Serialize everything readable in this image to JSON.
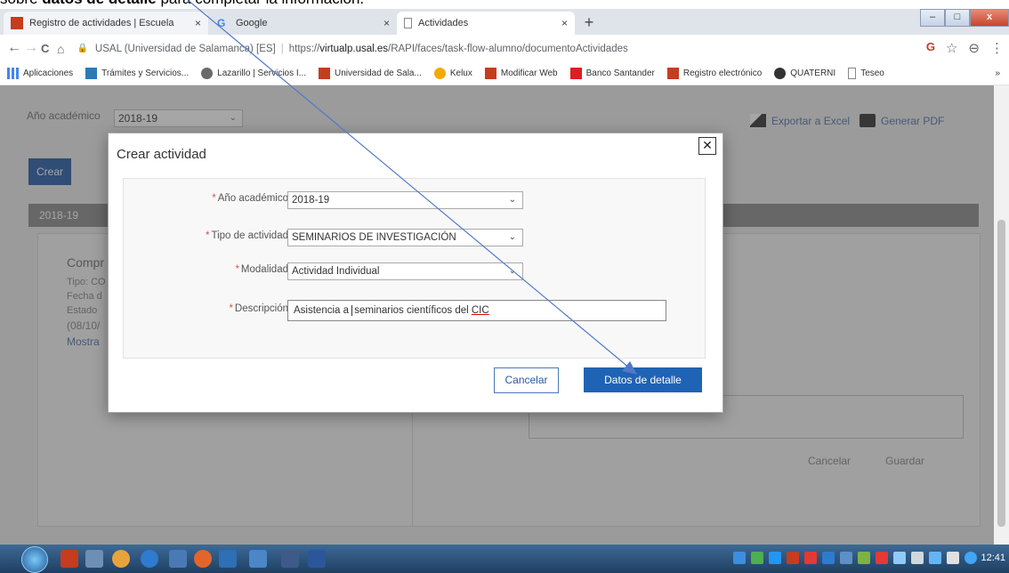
{
  "caption": {
    "prefix": "sobre ",
    "bold": "datos de detalle",
    "suffix": " para completar la información."
  },
  "browser": {
    "tabs": [
      {
        "title": "Registro de actividades | Escuela",
        "color": "#c63c1f"
      },
      {
        "title": "Google",
        "color": "#4285f4"
      },
      {
        "title": "Actividades",
        "color": "#888888"
      }
    ],
    "tab_close": "×",
    "new_tab": "+",
    "window_controls": {
      "minimize": "–",
      "maximize": "□",
      "close": "x"
    },
    "nav": {
      "back": "←",
      "forward": "→",
      "reload": "C",
      "home": "⌂"
    },
    "url": {
      "site": "USAL (Universidad de Salamanca) [ES]",
      "prefix": "https://",
      "domain": "virtualp.usal.es",
      "path": "/RAPI/faces/task-flow-alumno/documentoActividades"
    },
    "addr_icons": {
      "ext": "G",
      "star": "☆",
      "profile": "⊖",
      "menu": "⋮"
    },
    "bookmarks": [
      {
        "label": "Aplicaciones",
        "color": "#4285f4"
      },
      {
        "label": "Trámites y Servicios...",
        "color": "#2a7ab8"
      },
      {
        "label": "Lazarillo | Servicios I...",
        "color": "#6a6a6a"
      },
      {
        "label": "Universidad de Sala...",
        "color": "#c63c1f"
      },
      {
        "label": "Kelux",
        "color": "#f2a900"
      },
      {
        "label": "Modificar Web",
        "color": "#c63c1f"
      },
      {
        "label": "Banco Santander",
        "color": "#e31b23"
      },
      {
        "label": "Registro electrónico",
        "color": "#c63c1f"
      },
      {
        "label": "QUATERNI",
        "color": "#333333"
      },
      {
        "label": "Teseo",
        "color": "#888888"
      }
    ],
    "bookmarks_more": "»"
  },
  "page": {
    "year_filter_label": "Año académico",
    "year_filter_value": "2018-19",
    "export_excel": "Exportar a Excel",
    "export_pdf": "Generar PDF",
    "crear": "Crear",
    "year_bar": "2018-19",
    "comp_title": "Compr",
    "comp_lines": [
      "Tipo: CO",
      "Fecha d",
      "Estado",
      "(08/10/",
      "Mostra"
    ],
    "bg_cancel": "Cancelar",
    "bg_guardar": "Guardar"
  },
  "modal": {
    "title": "Crear actividad",
    "close": "✕",
    "fields": [
      {
        "label": "Año académico",
        "value": "2018-19"
      },
      {
        "label": "Tipo de actividad",
        "value": "SEMINARIOS DE INVESTIGACIÓN"
      },
      {
        "label": "Modalidad",
        "value": "Actividad Individual"
      }
    ],
    "description_label": "Descripción",
    "description_value_a": "Asistencia a ",
    "description_value_b": "seminarios científicos del ",
    "description_value_c": "CIC",
    "required_mark": "*",
    "cancel": "Cancelar",
    "detail": "Datos de detalle"
  },
  "taskbar": {
    "clock": "12:41"
  },
  "colors": {
    "primary": "#1f63b5",
    "arrow": "#4f79c9",
    "required": "#d9534f"
  }
}
